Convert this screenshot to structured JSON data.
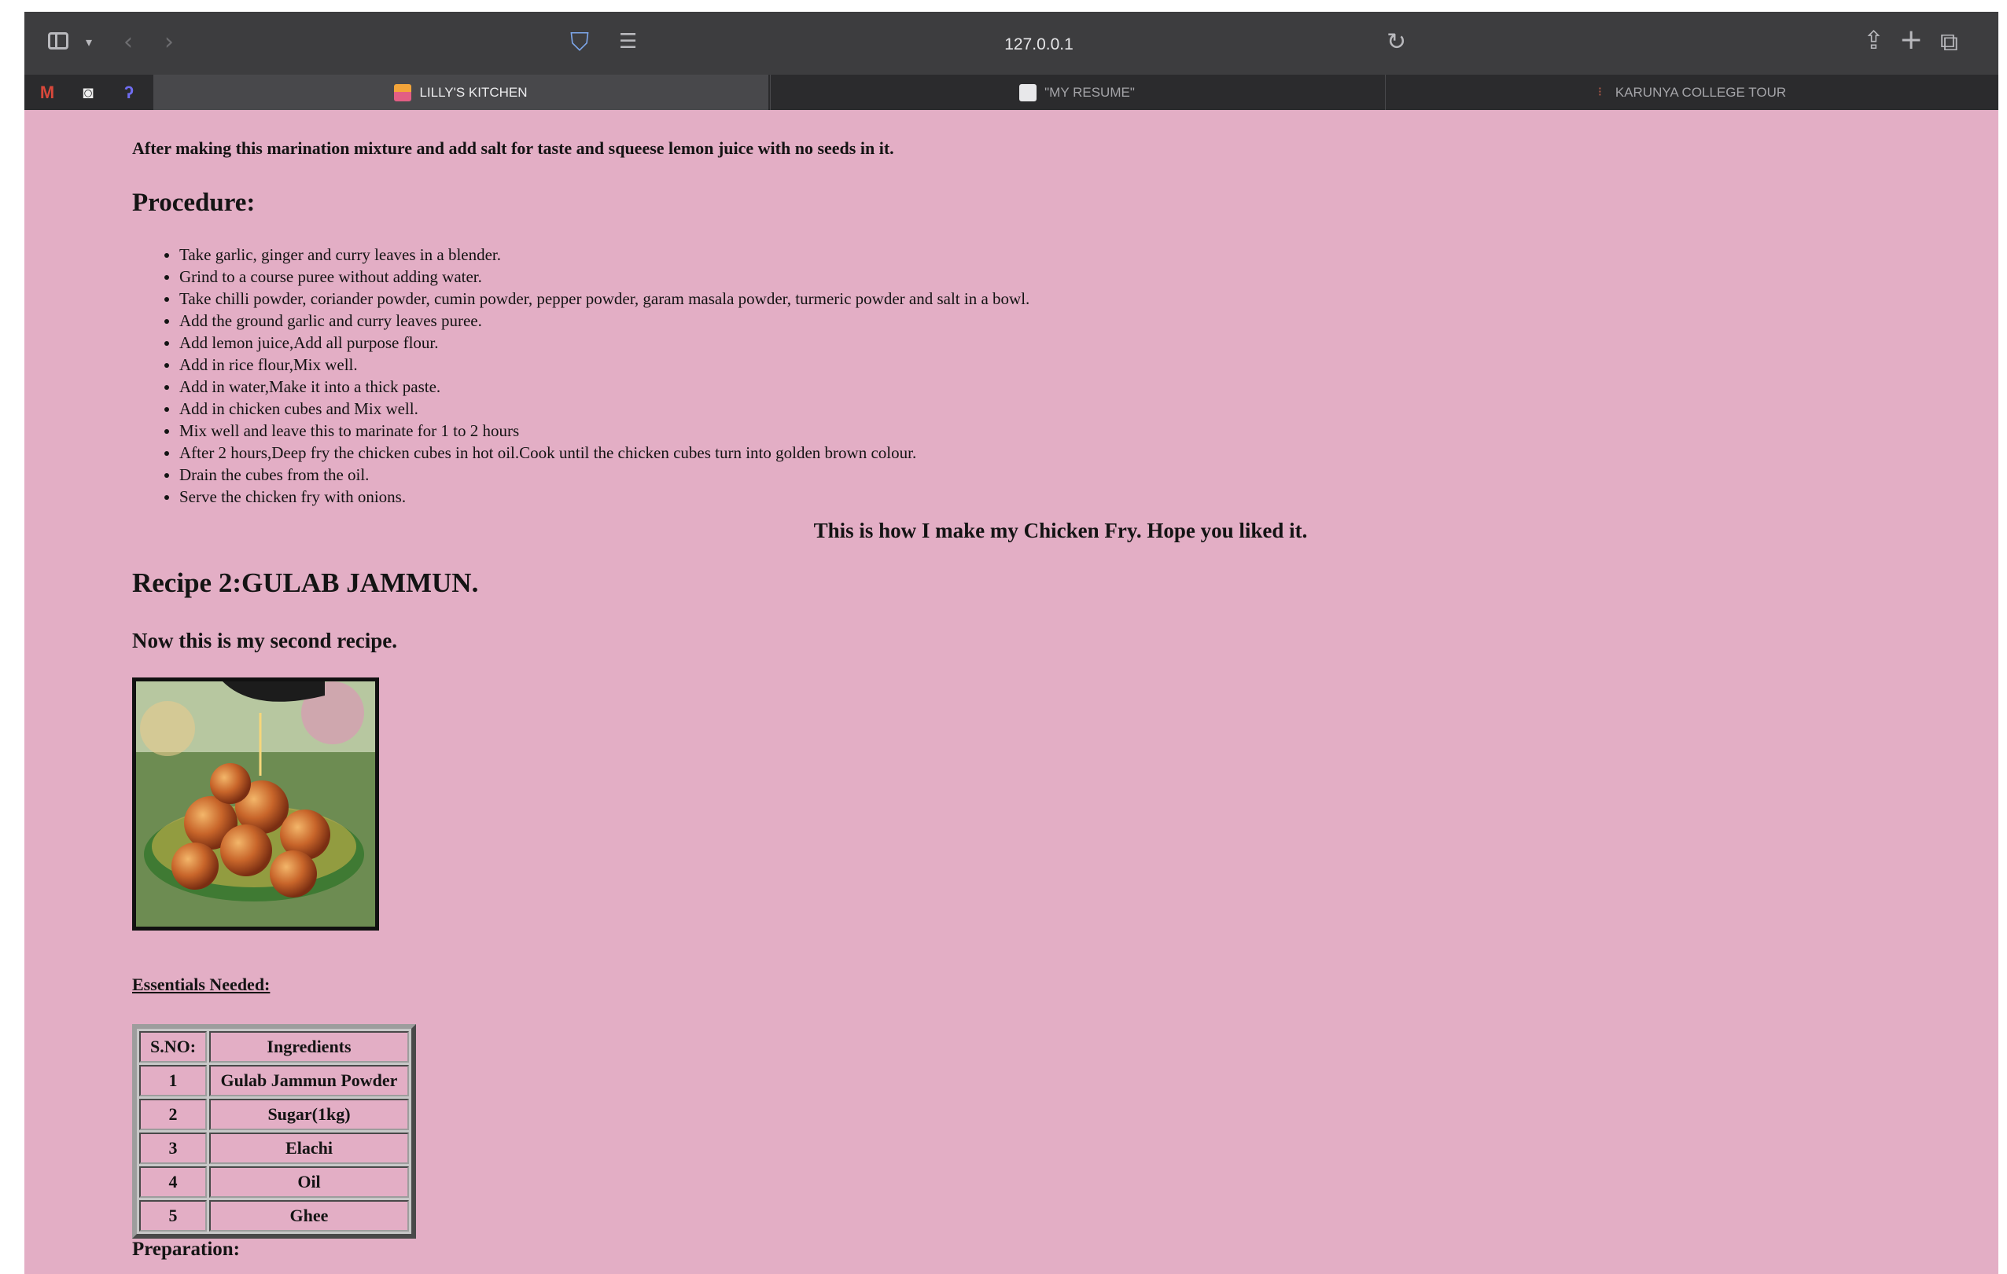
{
  "browser": {
    "url": "127.0.0.1",
    "tabs": [
      {
        "label": "LILLY'S KITCHEN",
        "active": true
      },
      {
        "label": "\"MY RESUME\"",
        "active": false
      },
      {
        "label": "KARUNYA COLLEGE TOUR",
        "active": false
      }
    ],
    "pinned": [
      {
        "icon": "gmail-icon",
        "glyph": "M"
      },
      {
        "icon": "ghost-icon",
        "glyph": "◙"
      },
      {
        "icon": "app-icon",
        "glyph": "ʔ"
      }
    ],
    "colors": {
      "toolbar": "#3d3d3f",
      "tabbar": "#2b2b2d",
      "active_tab": "#48484b",
      "page_background": "#e3aec5"
    }
  },
  "page": {
    "intro": "After making this marination mixture and add salt for taste and squeese lemon juice with no seeds in it.",
    "procedure_heading": "Procedure:",
    "steps": [
      "Take garlic, ginger and curry leaves in a blender.",
      "Grind to a course puree without adding water.",
      "Take chilli powder, coriander powder, cumin powder, pepper powder, garam masala powder, turmeric powder and salt in a bowl.",
      "Add the ground garlic and curry leaves puree.",
      "Add lemon juice,Add all purpose flour.",
      "Add in rice flour,Mix well.",
      "Add in water,Make it into a thick paste.",
      "Add in chicken cubes and Mix well.",
      "Mix well and leave this to marinate for 1 to 2 hours",
      "After 2 hours,Deep fry the chicken cubes in hot oil.Cook until the chicken cubes turn into golden brown colour.",
      "Drain the cubes from the oil.",
      "Serve the chicken fry with onions."
    ],
    "closing": "This is how I make my Chicken Fry. Hope you liked it.",
    "recipe2_heading": "Recipe 2:GULAB JAMMUN.",
    "recipe2_intro": "Now this is my second recipe.",
    "essentials_heading": "Essentials Needed:",
    "table": {
      "headers": [
        "S.NO:",
        "Ingredients"
      ],
      "rows": [
        [
          "1",
          "Gulab Jammun Powder"
        ],
        [
          "2",
          "Sugar(1kg)"
        ],
        [
          "3",
          "Elachi"
        ],
        [
          "4",
          "Oil"
        ],
        [
          "5",
          "Ghee"
        ]
      ]
    },
    "preparation_heading": "Preparation:"
  }
}
